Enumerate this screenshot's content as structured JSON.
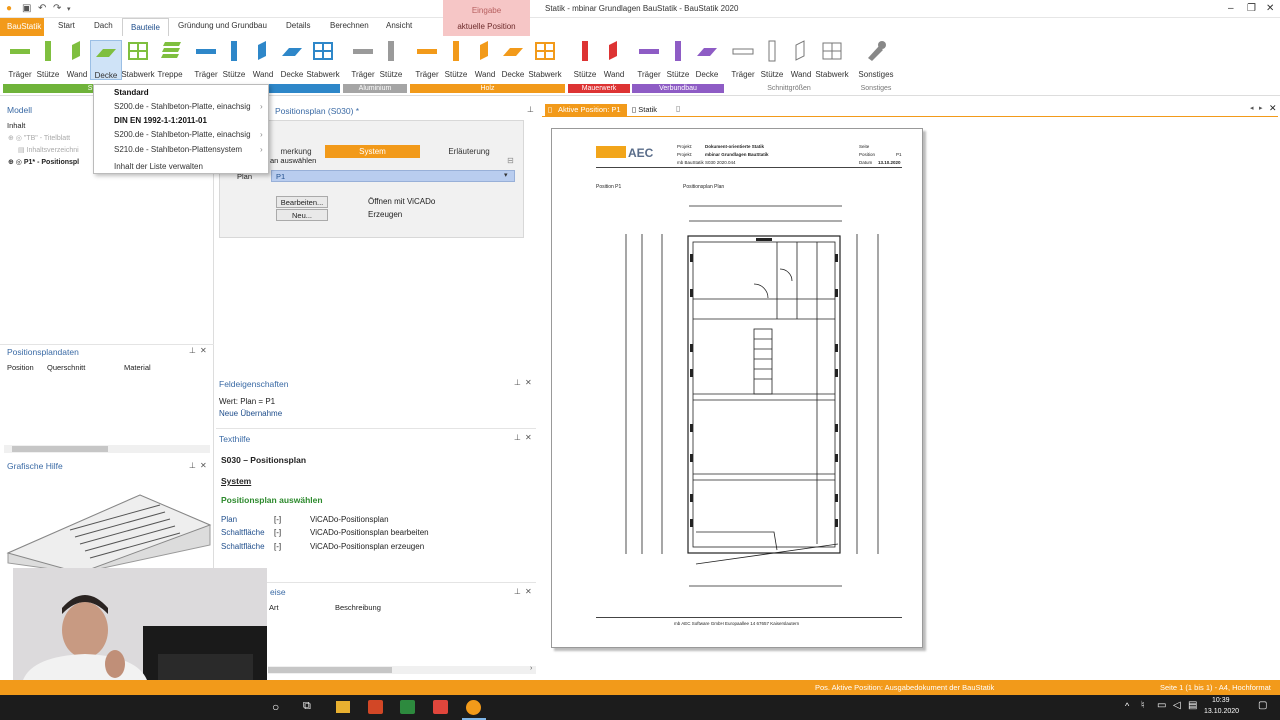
{
  "window": {
    "title": "Statik - mbinar Grundlagen BauStatik - BauStatik 2020"
  },
  "tabs": {
    "app": "BauStatik",
    "start": "Start",
    "dach": "Dach",
    "bauteile": "Bauteile",
    "gruendung": "Gründung und Grundbau",
    "details": "Details",
    "berechnen": "Berechnen",
    "ansicht": "Ansicht"
  },
  "context_tab": {
    "line1": "Eingabe",
    "line2": "aktuelle Position"
  },
  "ribbon": {
    "buttons": [
      "Träger",
      "Stütze",
      "Wand",
      "Decke",
      "Stabwerk",
      "Treppe",
      "Träger",
      "Stütze",
      "Wand",
      "Decke",
      "Stabwerk",
      "Träger",
      "Stütze",
      "Träger",
      "Stütze",
      "Wand",
      "Decke",
      "Stabwerk",
      "Stütze",
      "Wand",
      "Träger",
      "Stütze",
      "Decke",
      "Träger",
      "Stütze",
      "Wand",
      "Stabwerk",
      "Sonstiges"
    ],
    "groups": {
      "g1": "Stah",
      "g2": "hl",
      "g3": "Aluminium",
      "g4": "Holz",
      "g5": "Mauerwerk",
      "g6": "Verbundbau",
      "g7": "Schnittgrößen",
      "g8": "Sonstiges"
    }
  },
  "dropdown": {
    "header": "Standard",
    "items": [
      "S200.de - Stahlbeton-Platte, einachsig",
      "DIN EN 1992-1-1:2011-01",
      "S200.de - Stahlbeton-Platte, einachsig",
      "S210.de - Stahlbeton-Plattensystem",
      "Inhalt der Liste verwalten"
    ]
  },
  "model_panel": {
    "title": "Modell",
    "section": "Inhalt",
    "tree": [
      "\"TB\" - Titelblatt",
      "Inhaltsverzeichni",
      "P1* - Positionspl"
    ]
  },
  "position_panel": {
    "title": "Positionsplan (S030) *",
    "tabs": [
      "merkung",
      "System",
      "Erläuterung"
    ],
    "group": "an auswählen",
    "plan_label": "Plan",
    "plan_value": "P1",
    "btn_edit": "Bearbeiten...",
    "btn_new": "Neu...",
    "desc_edit": "Öffnen mit ViCADo",
    "desc_new": "Erzeugen"
  },
  "posdata_panel": {
    "title": "Positionsplandaten",
    "cols": [
      "Position",
      "Querschnitt",
      "Material"
    ]
  },
  "field_panel": {
    "title": "Feldeigenschaften",
    "line1": "Wert: Plan = P1",
    "line2": "Neue Übernahme"
  },
  "texthelp": {
    "title": "Texthilfe",
    "heading": "S030 – Positionsplan",
    "system": "System",
    "subheading": "Positionsplan auswählen",
    "rows": [
      {
        "name": "Plan",
        "bracket": "[-]",
        "desc": "ViCADo-Positionsplan"
      },
      {
        "name": "Schaltfläche",
        "bracket": "[-]",
        "desc": "ViCADo-Positionsplan bearbeiten"
      },
      {
        "name": "Schaltfläche",
        "bracket": "[-]",
        "desc": "ViCADo-Positionsplan erzeugen"
      }
    ]
  },
  "hints_panel": {
    "title": "eise",
    "cols": [
      "Art",
      "Beschreibung"
    ]
  },
  "graphic_help": {
    "title": "Grafische Hilfe"
  },
  "preview": {
    "tab_active": "Aktive Position: P1",
    "tab_statik": "Statik",
    "doc": {
      "projekt_label": "Projekt:",
      "projekt_value": "Dokument-orientierte Statik",
      "projekt2_label": "Projekt:",
      "projekt2_value": "mbinar Grundlagen BauStatik",
      "software": "mb BauStatik S030 2020.044",
      "seite_label": "Seite",
      "position_label": "Position",
      "position_value": "P1",
      "datum_label": "Datum",
      "datum_value": "13.10.2020",
      "pos_title": "Position P1",
      "plan_title": "Positionsplan Plan",
      "footer": "mb AEC Software GmbH    Europaallee 14    67657 Kaiserslautern",
      "logo": "mbAEC"
    }
  },
  "status": {
    "left": "Pos. Aktive Position: Ausgabedokument der BauStatik",
    "right": "Seite 1 (1 bis 1) - A4, Hochformat"
  },
  "taskbar": {
    "time": "10:39",
    "date": "13.10.2020"
  }
}
